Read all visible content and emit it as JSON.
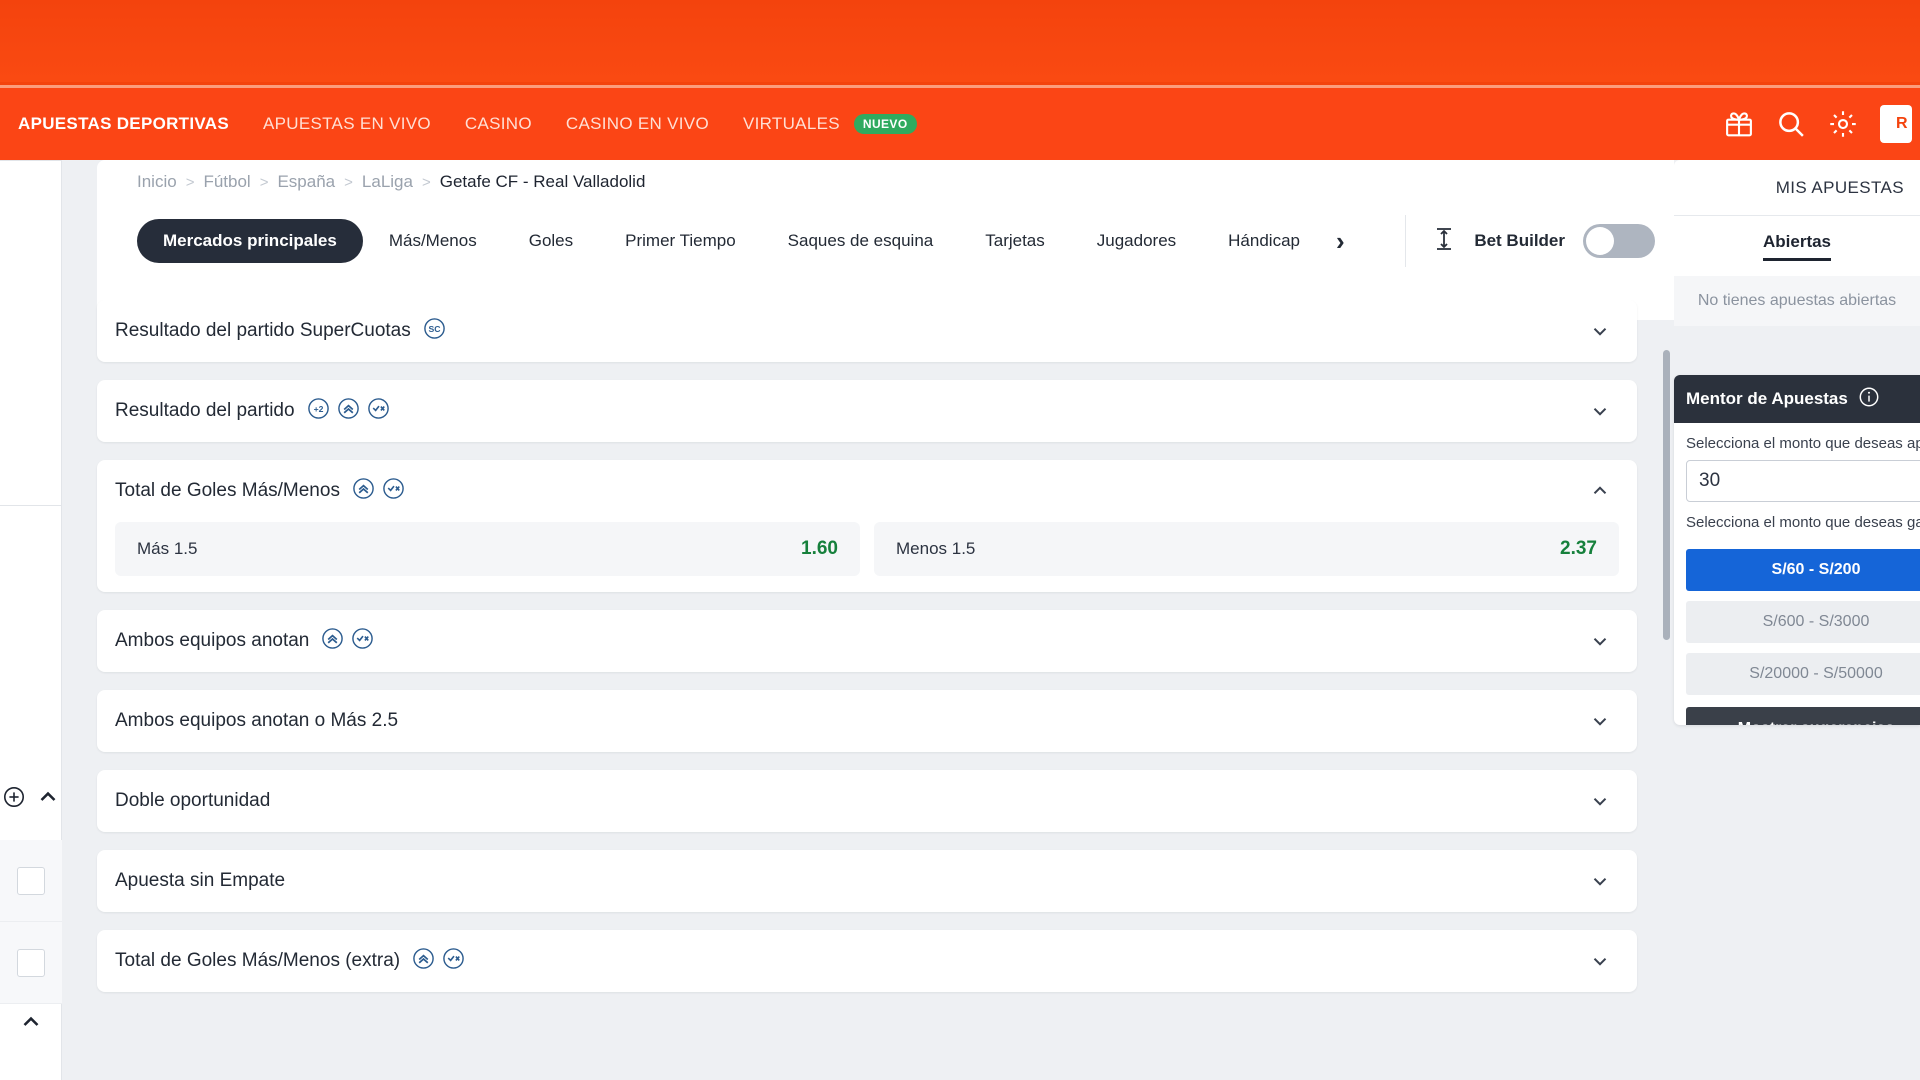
{
  "header": {
    "nav_items": [
      {
        "label": "APUESTAS DEPORTIVAS",
        "active": true,
        "badge": ""
      },
      {
        "label": "APUESTAS EN VIVO",
        "active": false,
        "badge": ""
      },
      {
        "label": "CASINO",
        "active": false,
        "badge": ""
      },
      {
        "label": "CASINO EN VIVO",
        "active": false,
        "badge": ""
      },
      {
        "label": "VIRTUALES",
        "active": false,
        "badge": "NUEVO"
      }
    ],
    "icons": [
      "gift-icon",
      "search-icon",
      "gear-icon"
    ],
    "register_label": "R",
    "brand_color": "#fb4515",
    "badge_color": "#2faa5f"
  },
  "breadcrumb": {
    "items": [
      "Inicio",
      "Fútbol",
      "España",
      "LaLiga"
    ],
    "current": "Getafe CF - Real Valladolid",
    "separator": ">"
  },
  "tabs": {
    "items": [
      {
        "label": "Mercados principales",
        "active": true
      },
      {
        "label": "Más/Menos",
        "active": false
      },
      {
        "label": "Goles",
        "active": false
      },
      {
        "label": "Primer Tiempo",
        "active": false
      },
      {
        "label": "Saques de esquina",
        "active": false
      },
      {
        "label": "Tarjetas",
        "active": false
      },
      {
        "label": "Jugadores",
        "active": false
      },
      {
        "label": "Hándicap",
        "active": false
      }
    ],
    "next_arrow": "›",
    "bet_builder": {
      "label": "Bet Builder",
      "icon": "bet-builder-icon",
      "enabled": false
    }
  },
  "markets": [
    {
      "title": "Resultado del partido SuperCuotas",
      "icons": [
        "supercuotas-icon"
      ],
      "expanded": false,
      "outcomes": []
    },
    {
      "title": "Resultado del partido",
      "icons": [
        "plus-two-icon",
        "boost-icon",
        "cashout-icon"
      ],
      "expanded": false,
      "outcomes": []
    },
    {
      "title": "Total de Goles Más/Menos",
      "icons": [
        "boost-icon",
        "cashout-icon"
      ],
      "expanded": true,
      "outcomes": [
        {
          "label": "Más 1.5",
          "odds": "1.60"
        },
        {
          "label": "Menos 1.5",
          "odds": "2.37"
        }
      ]
    },
    {
      "title": "Ambos equipos anotan",
      "icons": [
        "boost-icon",
        "cashout-icon"
      ],
      "expanded": false,
      "outcomes": []
    },
    {
      "title": "Ambos equipos anotan o Más 2.5",
      "icons": [],
      "expanded": false,
      "outcomes": []
    },
    {
      "title": "Doble oportunidad",
      "icons": [],
      "expanded": false,
      "outcomes": []
    },
    {
      "title": "Apuesta sin Empate",
      "icons": [],
      "expanded": false,
      "outcomes": []
    },
    {
      "title": "Total de Goles Más/Menos (extra)",
      "icons": [
        "boost-icon",
        "cashout-icon"
      ],
      "expanded": false,
      "outcomes": []
    }
  ],
  "right_panel": {
    "my_bets": {
      "title": "MIS APUESTAS",
      "tab_label": "Abiertas",
      "empty_message": "No tienes apuestas abiertas"
    },
    "mentor": {
      "title": "Mentor de Apuestas",
      "amount_label": "Selecciona el monto que deseas apostar",
      "amount_value": "30",
      "range_label": "Selecciona el monto que deseas ganar",
      "ranges": [
        {
          "label": "S/60 - S/200",
          "selected": true
        },
        {
          "label": "S/600 - S/3000",
          "selected": false
        },
        {
          "label": "S/20000 - S/50000",
          "selected": false
        }
      ],
      "submit_label": "Mostrar sugerencias",
      "accent_color": "#1565d8"
    }
  }
}
